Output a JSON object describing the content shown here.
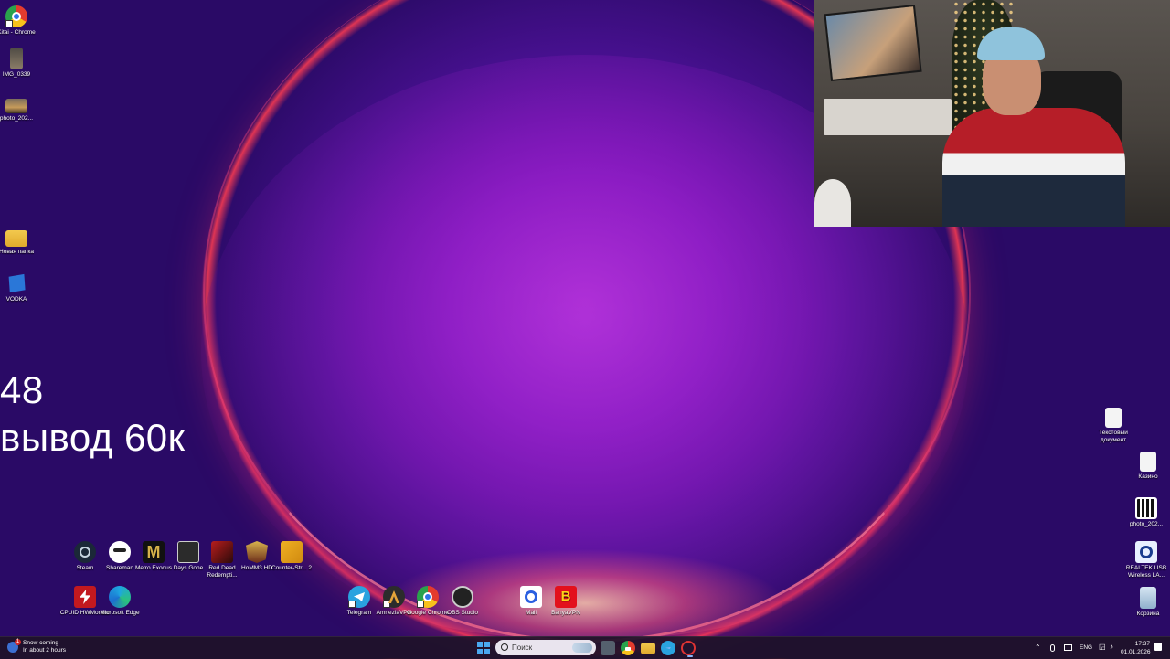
{
  "desktop_left": [
    {
      "label": "Kitai - Chrome",
      "icon": "chrome-icon"
    },
    {
      "label": "IMG_0339",
      "icon": "image-file-icon"
    },
    {
      "label": "photo_202...",
      "icon": "photo-file-icon"
    },
    {
      "label": "Новая папка",
      "icon": "folder-icon"
    },
    {
      "label": "VODKA",
      "icon": "vodka-app-icon"
    }
  ],
  "desktop_right": [
    {
      "label": "Текстовый документ",
      "icon": "text-document-icon"
    },
    {
      "label": "Казино",
      "icon": "document-icon"
    },
    {
      "label": "photo_202...",
      "icon": "qr-image-icon"
    },
    {
      "label": "REALTEK USB Wireless LA...",
      "icon": "realtek-icon"
    },
    {
      "label": "Корзина",
      "icon": "recycle-bin-icon"
    }
  ],
  "games_row1": [
    {
      "label": "Steam",
      "icon": "steam-icon"
    },
    {
      "label": "Shareman",
      "icon": "shareman-icon"
    },
    {
      "label": "Metro Exodus",
      "icon": "metro-exodus-icon"
    },
    {
      "label": "Days Gone",
      "icon": "days-gone-icon"
    },
    {
      "label": "Red Dead Redempti...",
      "icon": "red-dead-icon"
    },
    {
      "label": "HoMM3 HD",
      "icon": "homm3-icon"
    },
    {
      "label": "Counter-Str... 2",
      "icon": "counter-strike-icon"
    }
  ],
  "games_row2": [
    {
      "label": "CPUID HWMonitor",
      "icon": "cpuid-icon"
    },
    {
      "label": "Microsoft Edge",
      "icon": "edge-icon"
    }
  ],
  "apps_row": [
    {
      "label": "Telegram",
      "icon": "telegram-icon"
    },
    {
      "label": "AmneziaVPN",
      "icon": "amnezia-vpn-icon"
    },
    {
      "label": "Google Chrome",
      "icon": "chrome-icon"
    },
    {
      "label": "OBS Studio",
      "icon": "obs-icon"
    },
    {
      "label": "Mail",
      "icon": "mail-icon"
    },
    {
      "label": "BanyaVPN",
      "icon": "banya-vpn-icon"
    }
  ],
  "overlay": {
    "number": "48",
    "text": "вывод 60к"
  },
  "taskbar": {
    "weather_title": "Snow coming",
    "weather_sub": "In about 2 hours",
    "search_placeholder": "Поиск",
    "language": "ENG",
    "time": "17:37",
    "date": "01.01.2026"
  },
  "colors": {
    "wallpaper_core": "#a024c8",
    "rim": "#ff3c50",
    "taskbar": "#1e1228"
  }
}
